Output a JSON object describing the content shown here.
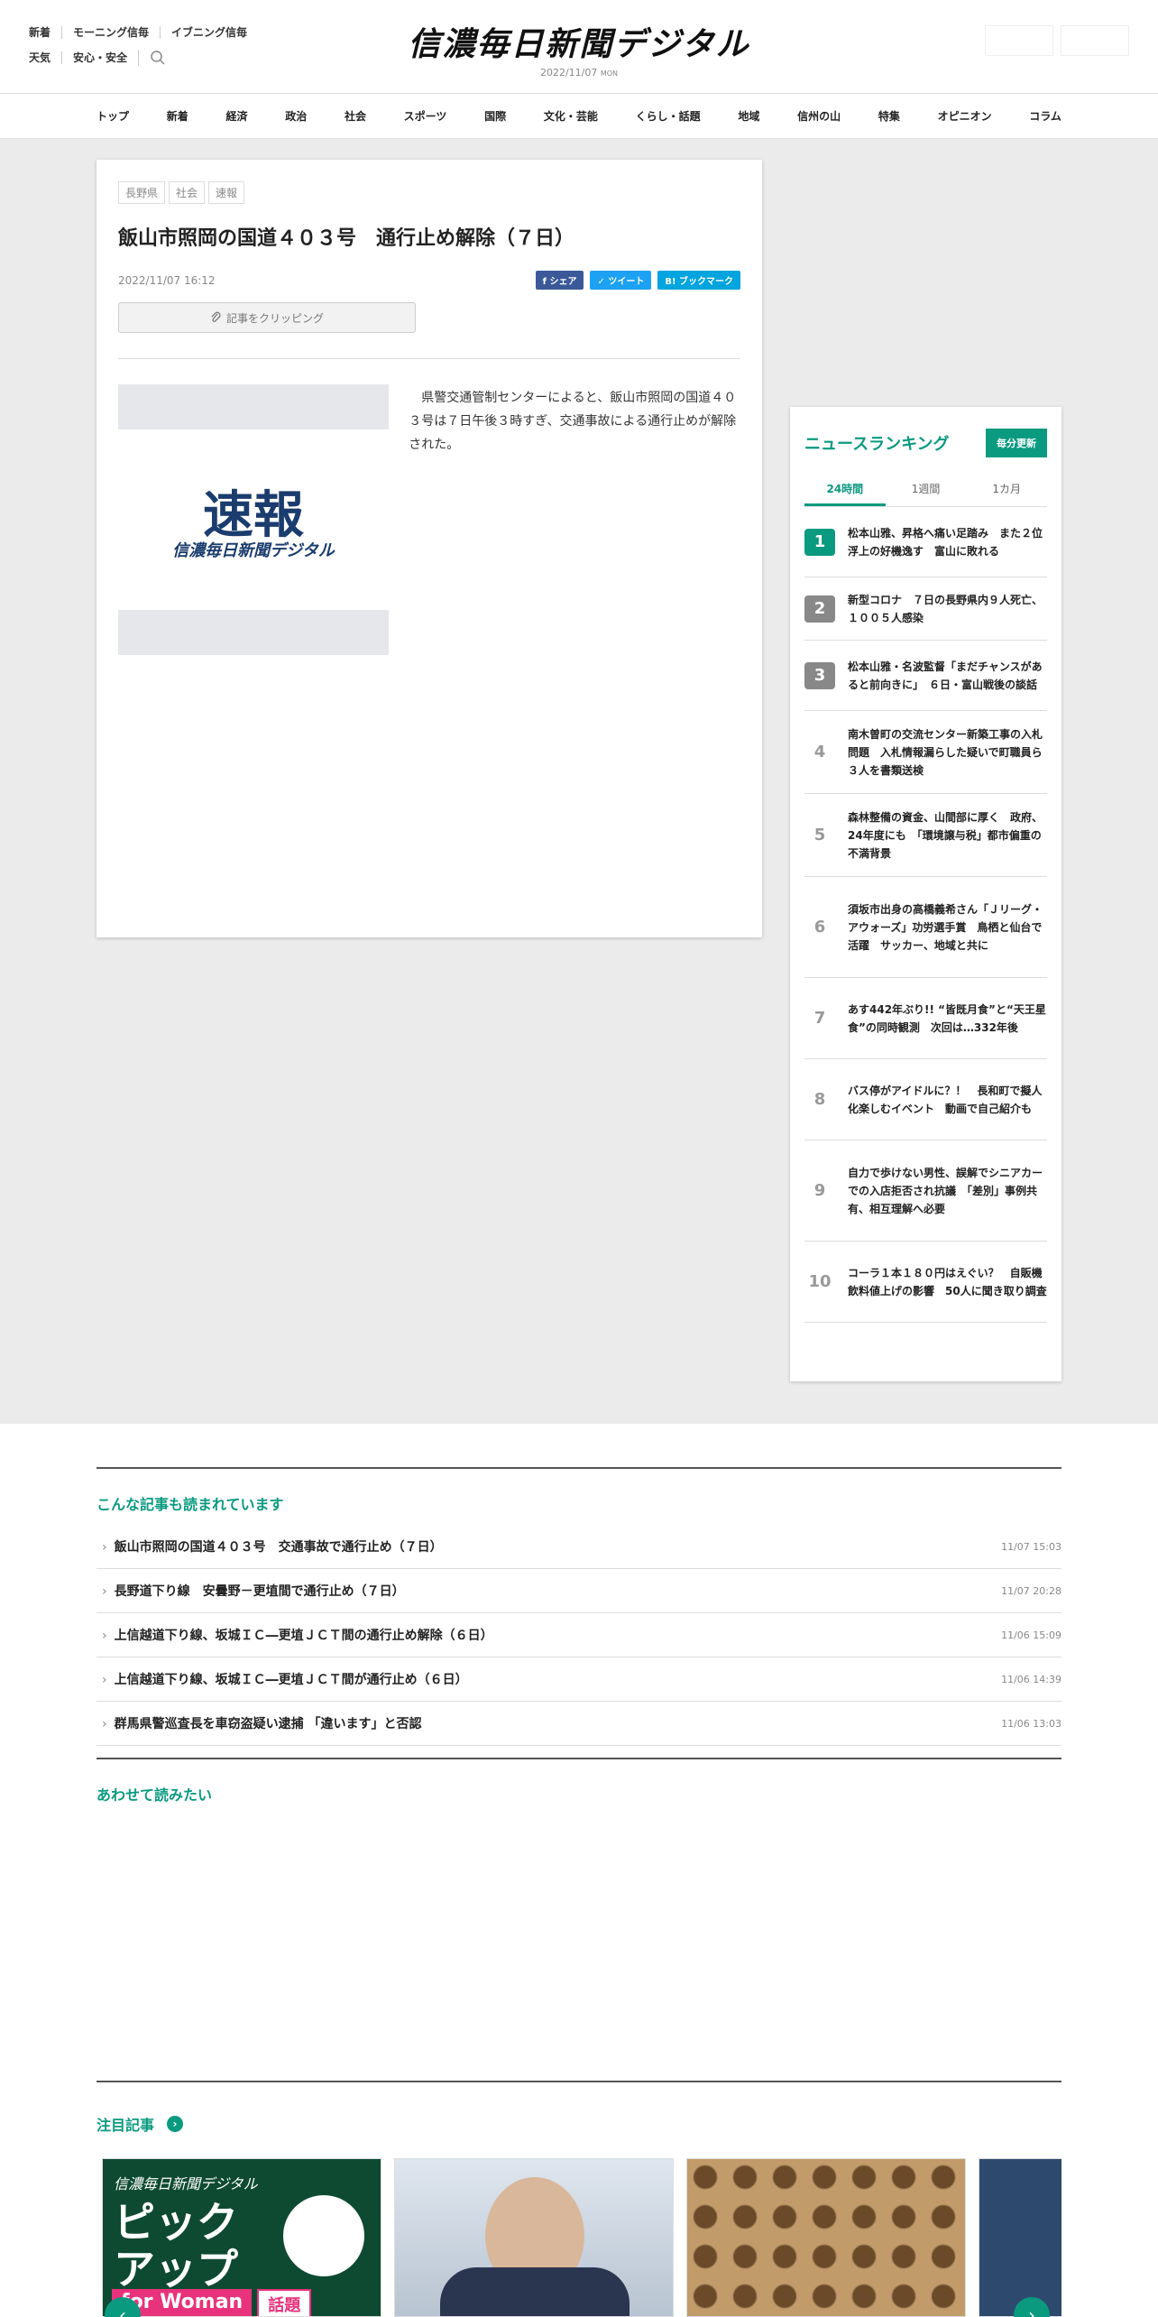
{
  "header": {
    "links_row1": [
      "新着",
      "モーニング信毎",
      "イブニング信毎"
    ],
    "links_row2": [
      "天気",
      "安心・安全"
    ],
    "logo": "信濃毎日新聞デジタル",
    "date": "2022/11/07",
    "day": "MON"
  },
  "nav": [
    "トップ",
    "新着",
    "経済",
    "政治",
    "社会",
    "スポーツ",
    "国際",
    "文化・芸能",
    "くらし・話題",
    "地域",
    "信州の山",
    "特集",
    "オピニオン",
    "コラム"
  ],
  "article": {
    "tags": [
      "長野県",
      "社会",
      "速報"
    ],
    "title": "飯山市照岡の国道４０３号　通行止め解除（７日）",
    "date": "2022/11/07 16:12",
    "share_fb": "シェア",
    "share_tw": "ツイート",
    "share_hb": "ブックマーク",
    "clip_label": "記事をクリッピング",
    "photo_main": "速報",
    "photo_sub": "信濃毎日新聞デジタル",
    "body": "　県警交通管制センターによると、飯山市照岡の国道４０３号は７日午後３時すぎ、交通事故による通行止めが解除された。"
  },
  "ranking": {
    "title": "ニュースランキング",
    "badge": "毎分更新",
    "tabs": [
      "24時間",
      "1週間",
      "1カ月"
    ],
    "items": [
      {
        "num": "1",
        "text": "松本山雅、昇格へ痛い足踏み　また２位浮上の好機逸す　富山に敗れる"
      },
      {
        "num": "2",
        "text": "新型コロナ　７日の長野県内９人死亡、１００５人感染"
      },
      {
        "num": "3",
        "text": "松本山雅・名波監督「まだチャンスがあると前向きに」　６日・富山戦後の談話"
      },
      {
        "num": "4",
        "text": "南木曽町の交流センター新築工事の入札問題　入札情報漏らした疑いで町職員ら３人を書類送検"
      },
      {
        "num": "5",
        "text": "森林整備の資金、山間部に厚く　政府、24年度にも　「環境譲与税」都市偏重の不満背景"
      },
      {
        "num": "6",
        "text": "須坂市出身の高橋義希さん「Ｊリーグ・アウォーズ」功労選手賞　鳥栖と仙台で活躍　サッカー、地域と共に"
      },
      {
        "num": "7",
        "text": "あす442年ぶり!! “皆既月食”と“天王星食”の同時観測　次回は…332年後"
      },
      {
        "num": "8",
        "text": "バス停がアイドルに？！　長和町で擬人化楽しむイベント　動画で自己紹介も"
      },
      {
        "num": "9",
        "text": "自力で歩けない男性、誤解でシニアカーでの入店拒否され抗議　「差別」事例共有、相互理解へ必要"
      },
      {
        "num": "10",
        "text": "コーラ１本１８０円はえぐい？　自販機飲料値上げの影響　50人に聞き取り調査"
      }
    ]
  },
  "related": {
    "title": "こんな記事も読まれています",
    "items": [
      {
        "text": "飯山市照岡の国道４０３号　交通事故で通行止め（７日）",
        "date": "11/07 15:03"
      },
      {
        "text": "長野道下り線　安曇野－更埴間で通行止め（７日）",
        "date": "11/07 20:28"
      },
      {
        "text": "上信越道下り線、坂城ＩＣ―更埴ＪＣＴ間の通行止め解除（６日）",
        "date": "11/06 15:09"
      },
      {
        "text": "上信越道下り線、坂城ＩＣ―更埴ＪＣＴ間が通行止め（６日）",
        "date": "11/06 14:39"
      },
      {
        "text": "群馬県警巡査長を車窃盗疑い逮捕 「違います」と否認",
        "date": "11/06 13:03"
      }
    ]
  },
  "also_read": {
    "title": "あわせて読みたい"
  },
  "featured": {
    "title": "注目記事",
    "card1_brand": "信濃毎日新聞デジタル",
    "card1_title": "ピックアップ",
    "card1_sub": "for Woman",
    "card1_tag": "話題"
  },
  "colors": {
    "accent": "#0a9a80",
    "fb": "#3b5998",
    "tw": "#1da1f2",
    "hb": "#00a4de"
  }
}
